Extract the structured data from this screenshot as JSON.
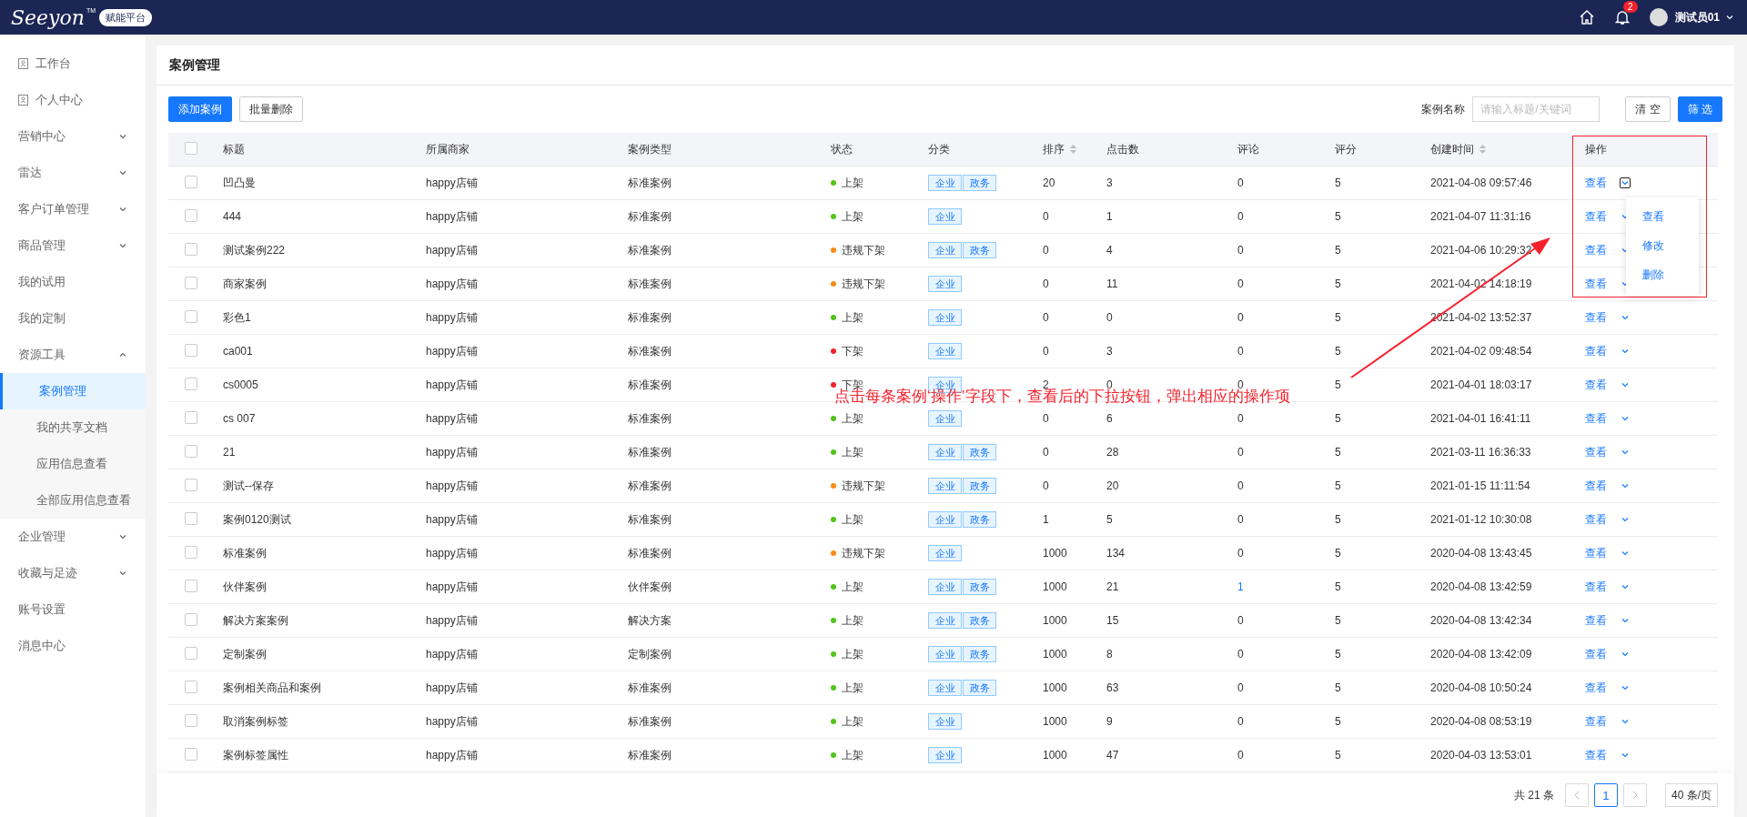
{
  "header": {
    "logo": "Seeyon",
    "logo_mark": "TM",
    "platform_badge": "赋能平台",
    "notification_count": "2",
    "user_name": "测试员01"
  },
  "sidebar": {
    "items": [
      {
        "kind": "icon-link",
        "label": "工作台"
      },
      {
        "kind": "icon-link",
        "label": "个人中心"
      },
      {
        "kind": "group",
        "label": "营销中心",
        "expanded": false
      },
      {
        "kind": "group",
        "label": "雷达",
        "expanded": false
      },
      {
        "kind": "group",
        "label": "客户订单管理",
        "expanded": false
      },
      {
        "kind": "group",
        "label": "商品管理",
        "expanded": false
      },
      {
        "kind": "link",
        "label": "我的试用"
      },
      {
        "kind": "link",
        "label": "我的定制"
      },
      {
        "kind": "group",
        "label": "资源工具",
        "expanded": true,
        "children": [
          {
            "label": "案例管理",
            "selected": true
          },
          {
            "label": "我的共享文档",
            "selected": false
          },
          {
            "label": "应用信息查看",
            "selected": false
          },
          {
            "label": "全部应用信息查看",
            "selected": false
          }
        ]
      },
      {
        "kind": "group",
        "label": "企业管理",
        "expanded": false
      },
      {
        "kind": "group",
        "label": "收藏与足迹",
        "expanded": false
      },
      {
        "kind": "link",
        "label": "账号设置"
      },
      {
        "kind": "link",
        "label": "消息中心"
      }
    ]
  },
  "page": {
    "title": "案例管理"
  },
  "toolbar": {
    "buttons": [
      {
        "label": "添加案例",
        "kind": "primary"
      },
      {
        "label": "批量删除",
        "kind": "default"
      }
    ],
    "search_label": "案例名称",
    "search": {
      "placeholder": "请输入标题/关键词"
    },
    "clear_button": "清 空",
    "filter_button": "筛 选"
  },
  "table": {
    "select_all": {
      "checked": false
    },
    "columns": [
      {
        "label": "标题",
        "sortable": false
      },
      {
        "label": "所属商家",
        "sortable": false
      },
      {
        "label": "案例类型",
        "sortable": false
      },
      {
        "label": "状态",
        "sortable": false
      },
      {
        "label": "分类",
        "sortable": false
      },
      {
        "label": "排序",
        "sortable": true
      },
      {
        "label": "点击数",
        "sortable": false
      },
      {
        "label": "评论",
        "sortable": false
      },
      {
        "label": "评分",
        "sortable": false
      },
      {
        "label": "创建时间",
        "sortable": true
      },
      {
        "label": "操作",
        "sortable": false
      }
    ],
    "rows": [
      {
        "checked": false,
        "title": "凹凸曼",
        "merchant": "happy店铺",
        "type": "标准案例",
        "status": "上架",
        "color": "#52c41a",
        "tags": [
          "企业",
          "政务"
        ],
        "order": "20",
        "clicks": "3",
        "comments": "0",
        "score": "5",
        "created": "2021-04-08 09:57:46",
        "action": "查看",
        "menu_open": true
      },
      {
        "checked": false,
        "title": "444",
        "merchant": "happy店铺",
        "type": "标准案例",
        "status": "上架",
        "color": "#52c41a",
        "tags": [
          "企业"
        ],
        "order": "0",
        "clicks": "1",
        "comments": "0",
        "score": "5",
        "created": "2021-04-07 11:31:16",
        "action": "查看",
        "menu_open": false
      },
      {
        "checked": false,
        "title": "测试案例222",
        "merchant": "happy店铺",
        "type": "标准案例",
        "status": "违规下架",
        "color": "#fa8c16",
        "tags": [
          "企业",
          "政务"
        ],
        "order": "0",
        "clicks": "4",
        "comments": "0",
        "score": "5",
        "created": "2021-04-06 10:29:32",
        "action": "查看",
        "menu_open": false
      },
      {
        "checked": false,
        "title": "商家案例",
        "merchant": "happy店铺",
        "type": "标准案例",
        "status": "违规下架",
        "color": "#fa8c16",
        "tags": [
          "企业"
        ],
        "order": "0",
        "clicks": "11",
        "comments": "0",
        "score": "5",
        "created": "2021-04-02 14:18:19",
        "action": "查看",
        "menu_open": false
      },
      {
        "checked": false,
        "title": "彩色1",
        "merchant": "happy店铺",
        "type": "标准案例",
        "status": "上架",
        "color": "#52c41a",
        "tags": [
          "企业"
        ],
        "order": "0",
        "clicks": "0",
        "comments": "0",
        "score": "5",
        "created": "2021-04-02 13:52:37",
        "action": "查看",
        "menu_open": false
      },
      {
        "checked": false,
        "title": "ca001",
        "merchant": "happy店铺",
        "type": "标准案例",
        "status": "下架",
        "color": "#f5222d",
        "tags": [
          "企业"
        ],
        "order": "0",
        "clicks": "3",
        "comments": "0",
        "score": "5",
        "created": "2021-04-02 09:48:54",
        "action": "查看",
        "menu_open": false
      },
      {
        "checked": false,
        "title": "cs0005",
        "merchant": "happy店铺",
        "type": "标准案例",
        "status": "下架",
        "color": "#f5222d",
        "tags": [
          "企业"
        ],
        "order": "2",
        "clicks": "0",
        "comments": "0",
        "score": "5",
        "created": "2021-04-01 18:03:17",
        "action": "查看",
        "menu_open": false
      },
      {
        "checked": false,
        "title": "cs 007",
        "merchant": "happy店铺",
        "type": "标准案例",
        "status": "上架",
        "color": "#52c41a",
        "tags": [
          "企业"
        ],
        "order": "0",
        "clicks": "6",
        "comments": "0",
        "score": "5",
        "created": "2021-04-01 16:41:11",
        "action": "查看",
        "menu_open": false
      },
      {
        "checked": false,
        "title": "21",
        "merchant": "happy店铺",
        "type": "标准案例",
        "status": "上架",
        "color": "#52c41a",
        "tags": [
          "企业",
          "政务"
        ],
        "order": "0",
        "clicks": "28",
        "comments": "0",
        "score": "5",
        "created": "2021-03-11 16:36:33",
        "action": "查看",
        "menu_open": false
      },
      {
        "checked": false,
        "title": "测试--保存",
        "merchant": "happy店铺",
        "type": "标准案例",
        "status": "违规下架",
        "color": "#fa8c16",
        "tags": [
          "企业",
          "政务"
        ],
        "order": "0",
        "clicks": "20",
        "comments": "0",
        "score": "5",
        "created": "2021-01-15 11:11:54",
        "action": "查看",
        "menu_open": false
      },
      {
        "checked": false,
        "title": "案例0120测试",
        "merchant": "happy店铺",
        "type": "标准案例",
        "status": "上架",
        "color": "#52c41a",
        "tags": [
          "企业",
          "政务"
        ],
        "order": "1",
        "clicks": "5",
        "comments": "0",
        "score": "5",
        "created": "2021-01-12 10:30:08",
        "action": "查看",
        "menu_open": false
      },
      {
        "checked": false,
        "title": "标准案例",
        "merchant": "happy店铺",
        "type": "标准案例",
        "status": "违规下架",
        "color": "#fa8c16",
        "tags": [
          "企业"
        ],
        "order": "1000",
        "clicks": "134",
        "comments": "0",
        "score": "5",
        "created": "2020-04-08 13:43:45",
        "action": "查看",
        "menu_open": false
      },
      {
        "checked": false,
        "title": "伙伴案例",
        "merchant": "happy店铺",
        "type": "伙伴案例",
        "status": "上架",
        "color": "#52c41a",
        "tags": [
          "企业",
          "政务"
        ],
        "order": "1000",
        "clicks": "21",
        "comments": "1",
        "score": "5",
        "created": "2020-04-08 13:42:59",
        "action": "查看",
        "menu_open": false
      },
      {
        "checked": false,
        "title": "解决方案案例",
        "merchant": "happy店铺",
        "type": "解决方案",
        "status": "上架",
        "color": "#52c41a",
        "tags": [
          "企业",
          "政务"
        ],
        "order": "1000",
        "clicks": "15",
        "comments": "0",
        "score": "5",
        "created": "2020-04-08 13:42:34",
        "action": "查看",
        "menu_open": false
      },
      {
        "checked": false,
        "title": "定制案例",
        "merchant": "happy店铺",
        "type": "定制案例",
        "status": "上架",
        "color": "#52c41a",
        "tags": [
          "企业",
          "政务"
        ],
        "order": "1000",
        "clicks": "8",
        "comments": "0",
        "score": "5",
        "created": "2020-04-08 13:42:09",
        "action": "查看",
        "menu_open": false
      },
      {
        "checked": false,
        "title": "案例相关商品和案例",
        "merchant": "happy店铺",
        "type": "标准案例",
        "status": "上架",
        "color": "#52c41a",
        "tags": [
          "企业",
          "政务"
        ],
        "order": "1000",
        "clicks": "63",
        "comments": "0",
        "score": "5",
        "created": "2020-04-08 10:50:24",
        "action": "查看",
        "menu_open": false
      },
      {
        "checked": false,
        "title": "取消案例标签",
        "merchant": "happy店铺",
        "type": "标准案例",
        "status": "上架",
        "color": "#52c41a",
        "tags": [
          "企业"
        ],
        "order": "1000",
        "clicks": "9",
        "comments": "0",
        "score": "5",
        "created": "2020-04-08 08:53:19",
        "action": "查看",
        "menu_open": false
      },
      {
        "checked": false,
        "title": "案例标签属性",
        "merchant": "happy店铺",
        "type": "标准案例",
        "status": "上架",
        "color": "#52c41a",
        "tags": [
          "企业"
        ],
        "order": "1000",
        "clicks": "47",
        "comments": "0",
        "score": "5",
        "created": "2020-04-03 13:53:01",
        "action": "查看",
        "menu_open": false
      }
    ]
  },
  "action_menu": {
    "items": [
      "查看",
      "修改",
      "删除"
    ]
  },
  "annotation": {
    "text": "点击每条案例‘操作’字段下，查看后的下拉按钮，弹出相应的操作项"
  },
  "pagination": {
    "total": "共 21 条",
    "pages": [
      {
        "label": "1",
        "selected": true
      }
    ],
    "page_size": "40 条/页"
  }
}
